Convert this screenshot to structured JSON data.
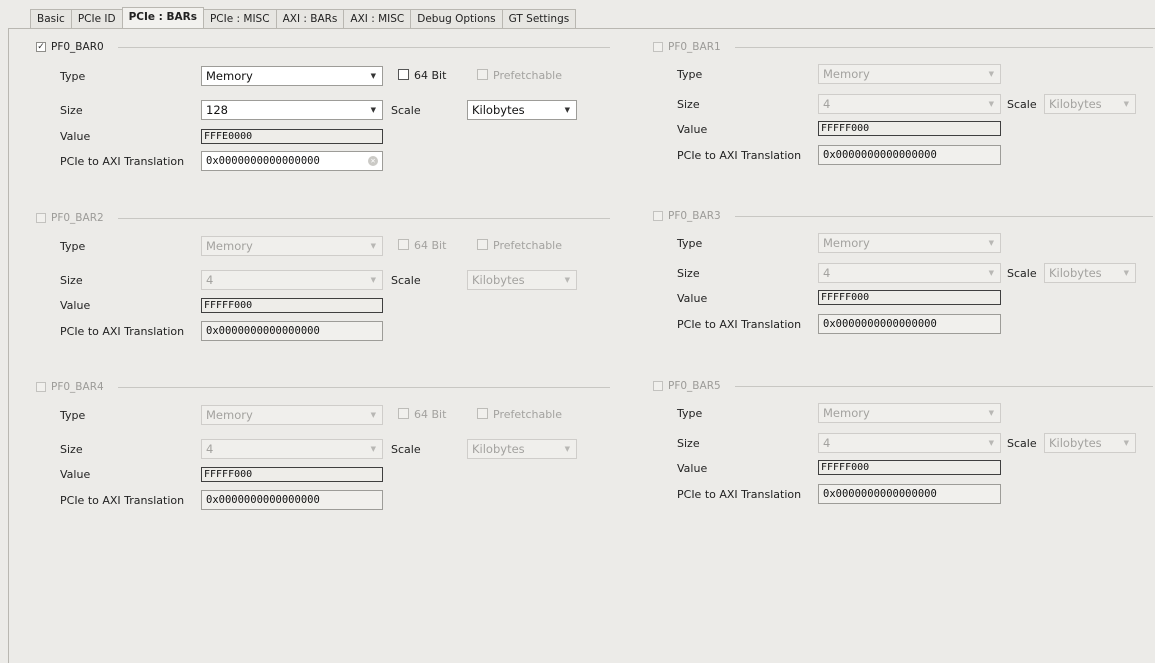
{
  "tabs": [
    {
      "label": "Basic",
      "active": false
    },
    {
      "label": "PCIe ID",
      "active": false
    },
    {
      "label": "PCIe : BARs",
      "active": true
    },
    {
      "label": "PCIe : MISC",
      "active": false
    },
    {
      "label": "AXI : BARs",
      "active": false
    },
    {
      "label": "AXI : MISC",
      "active": false
    },
    {
      "label": "Debug Options",
      "active": false
    },
    {
      "label": "GT Settings",
      "active": false
    }
  ],
  "labels": {
    "type": "Type",
    "size": "Size",
    "value": "Value",
    "translation": "PCIe to AXI Translation",
    "scale": "Scale",
    "bit64": "64 Bit",
    "prefetchable": "Prefetchable"
  },
  "bars": [
    {
      "name": "PF0_BAR0",
      "checked": true,
      "type": "Memory",
      "size": "128",
      "scale": "Kilobytes",
      "value": "FFFE0000",
      "translation": "0x0000000000000000"
    },
    {
      "name": "PF0_BAR1",
      "checked": false,
      "type": "Memory",
      "size": "4",
      "scale": "Kilobytes",
      "value": "FFFFF000",
      "translation": "0x0000000000000000"
    },
    {
      "name": "PF0_BAR2",
      "checked": false,
      "type": "Memory",
      "size": "4",
      "scale": "Kilobytes",
      "value": "FFFFF000",
      "translation": "0x0000000000000000"
    },
    {
      "name": "PF0_BAR3",
      "checked": false,
      "type": "Memory",
      "size": "4",
      "scale": "Kilobytes",
      "value": "FFFFF000",
      "translation": "0x0000000000000000"
    },
    {
      "name": "PF0_BAR4",
      "checked": false,
      "type": "Memory",
      "size": "4",
      "scale": "Kilobytes",
      "value": "FFFFF000",
      "translation": "0x0000000000000000"
    },
    {
      "name": "PF0_BAR5",
      "checked": false,
      "type": "Memory",
      "size": "4",
      "scale": "Kilobytes",
      "value": "FFFFF000",
      "translation": "0x0000000000000000"
    }
  ],
  "icons": {
    "checkmark": "check-icon",
    "dropdown": "chevron-down-icon",
    "clear": "clear-icon"
  }
}
